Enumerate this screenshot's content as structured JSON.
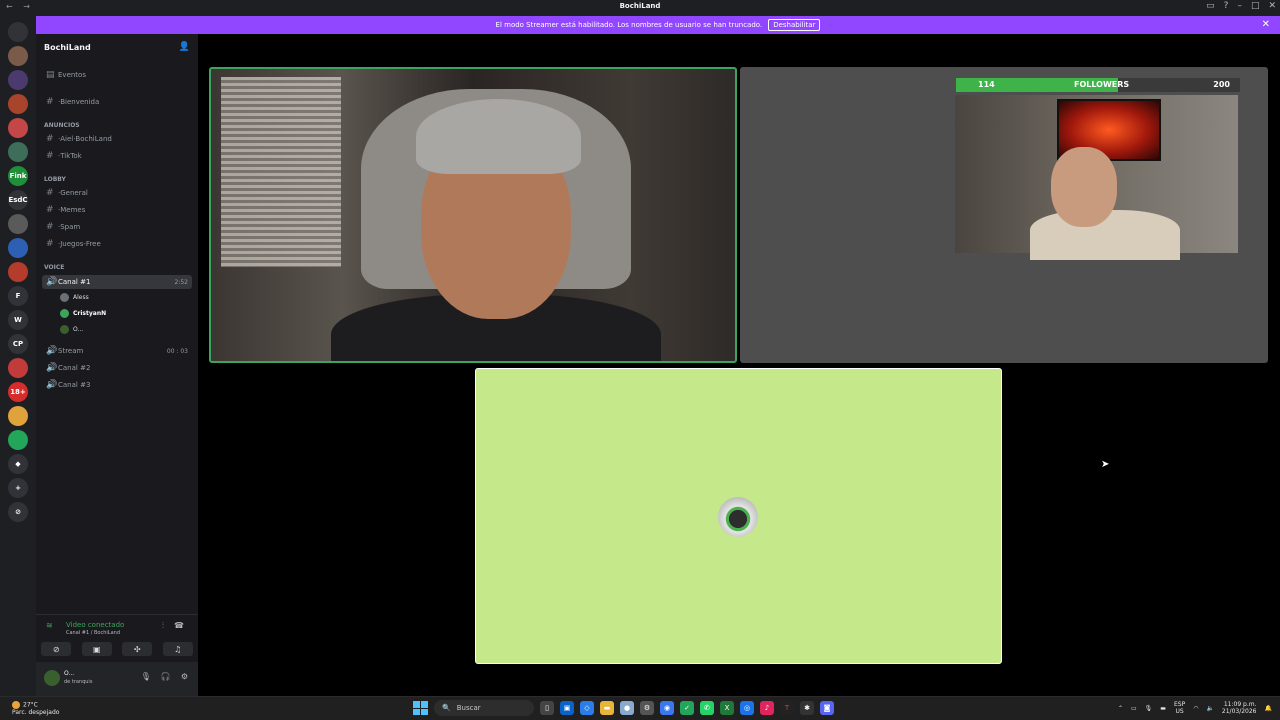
{
  "titlebar": {
    "title": "BochiLand",
    "nav": "← →"
  },
  "banner": {
    "message": "El modo Streamer está habilitado. Los nombres de usuario se han truncado.",
    "button": "Deshabilitar",
    "close": "✕"
  },
  "servers": [
    "",
    "",
    "",
    "",
    "",
    "",
    "",
    "Fink",
    "EsdC",
    "",
    "",
    "",
    "F",
    "W",
    "CP",
    "",
    "18+",
    "",
    "",
    "",
    "",
    ""
  ],
  "guild": {
    "name": "BochiLand",
    "events": "Eventos"
  },
  "channels": {
    "bienvenida": "·Bienvenida",
    "cat_anuncios": "ANUNCIOS",
    "aiel": "·Aiel·BochiLand",
    "tiktok": "·TikTok",
    "cat_lobby": "LOBBY",
    "general": "·General",
    "memes": "·Memes",
    "spam": "·Spam",
    "juegos": "·Juegos-Free",
    "cat_voice": "VOICE",
    "canal1": "Canal #1",
    "canal1_time": "2:52",
    "stream": "Stream",
    "stream_time": "00 : 03",
    "canal2": "Canal #2",
    "canal3": "Canal #3"
  },
  "members": [
    "Aless",
    "CristyanN",
    "O..."
  ],
  "voice_panel": {
    "title": "Video conectado",
    "subtitle": "Canal #1 / BochiLand"
  },
  "user_panel": {
    "name": "O...",
    "status": "de tranquis"
  },
  "stream_overlay": {
    "current": "114",
    "label": "FOLLOWERS",
    "goal": "200",
    "progress": 0.57
  },
  "taskbar": {
    "weather_temp": "27°C",
    "weather_desc": "Parc. despejado",
    "search": "Buscar",
    "lang": "ESP",
    "lang2": "US",
    "time": "11:09 p.m.",
    "date": "21/03/2026"
  },
  "colors": {
    "banner": "#9147ff",
    "speaking": "#3ba55d",
    "tile_bg": "#c4e88a"
  }
}
